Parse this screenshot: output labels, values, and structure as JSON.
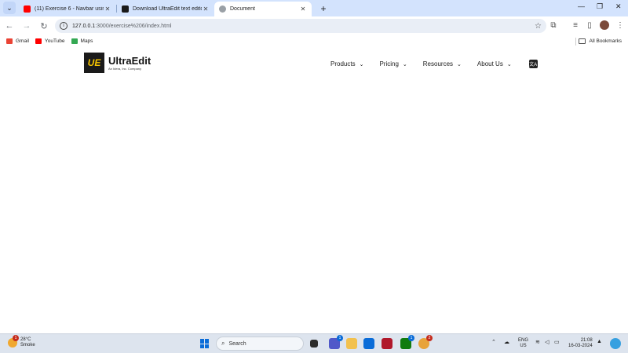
{
  "browser": {
    "tabs": [
      {
        "title": "(11) Exercise 6 - Navbar using I",
        "favicon_color": "#ff0000"
      },
      {
        "title": "Download UltraEdit text editor",
        "favicon_color": "#1a1a1a"
      },
      {
        "title": "Document",
        "favicon_color": "#9aa0a6",
        "active": true
      }
    ],
    "new_tab": "+",
    "address": {
      "host": "127.0.0.1",
      "path": ":3000/exercise%206/index.html"
    },
    "bookmarks": [
      {
        "label": "Gmail",
        "icon": "gmail-icon",
        "color": "#ea4335"
      },
      {
        "label": "YouTube",
        "icon": "youtube-icon",
        "color": "#ff0000"
      },
      {
        "label": "Maps",
        "icon": "maps-icon",
        "color": "#34a853"
      }
    ],
    "all_bookmarks": "All Bookmarks"
  },
  "site": {
    "logo_text": "UE",
    "brand_name": "UltraEdit",
    "brand_sub": "An Idera, Inc. Company",
    "nav": [
      {
        "label": "Products"
      },
      {
        "label": "Pricing"
      },
      {
        "label": "Resources"
      },
      {
        "label": "About Us"
      }
    ],
    "translate_icon": "文A"
  },
  "taskbar": {
    "weather_temp": "28°C",
    "weather_desc": "Smoke",
    "weather_badge": "1",
    "search_placeholder": "Search",
    "lang_top": "ENG",
    "lang_bottom": "US",
    "time": "21:08",
    "date": "16-03-2024",
    "teams_badge": "1",
    "xbox_badge": "1",
    "chrome_badge": "2"
  }
}
